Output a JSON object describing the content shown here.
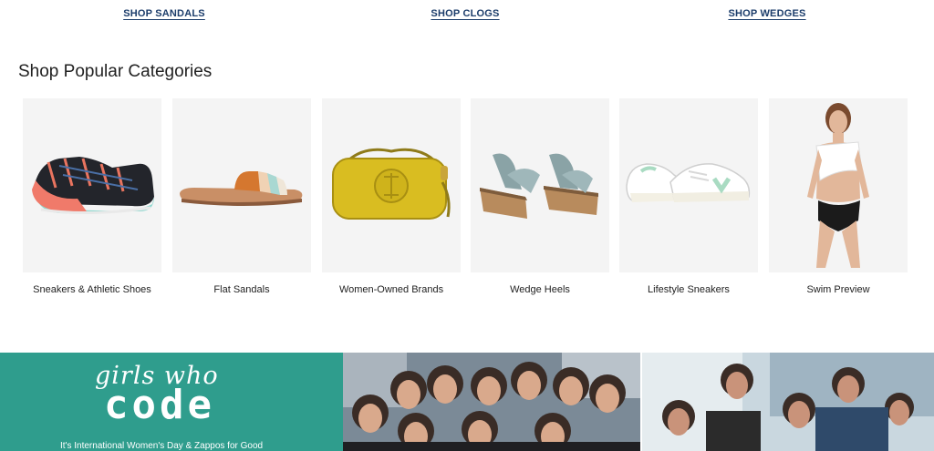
{
  "shop_links": {
    "sandals": "SHOP SANDALS",
    "clogs": "SHOP CLOGS",
    "wedges": "SHOP WEDGES"
  },
  "section_title": "Shop Popular Categories",
  "categories": [
    {
      "label": "Sneakers & Athletic Shoes",
      "icon": "running-shoe-icon"
    },
    {
      "label": "Flat Sandals",
      "icon": "slide-sandal-icon"
    },
    {
      "label": "Women-Owned Brands",
      "icon": "handbag-icon"
    },
    {
      "label": "Wedge Heels",
      "icon": "wedge-sandal-icon"
    },
    {
      "label": "Lifestyle Sneakers",
      "icon": "white-sneaker-icon"
    },
    {
      "label": "Swim Preview",
      "icon": "swimsuit-model-icon"
    }
  ],
  "banner": {
    "logo_script": "girls who",
    "logo_code": "code",
    "subtitle": "It's International Women's Day & Zappos for Good",
    "brand_color": "#2f9d8d"
  }
}
